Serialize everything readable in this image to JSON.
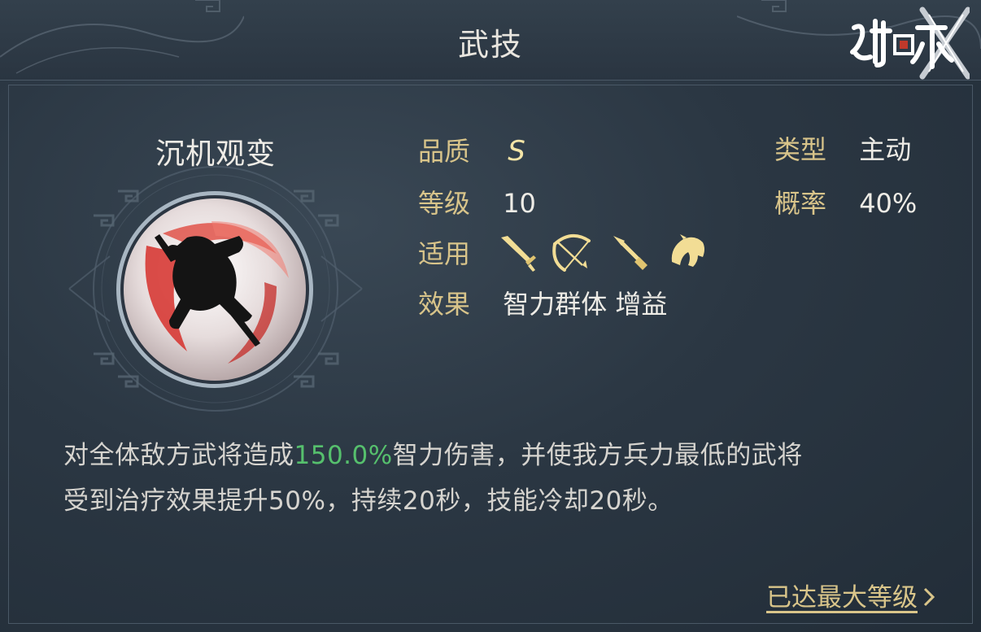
{
  "header": {
    "title": "武技",
    "logo_text": "鸿图之下"
  },
  "skill": {
    "name": "沉机观变",
    "icon": "warrior-silhouette-emblem-icon",
    "attributes": {
      "quality_label": "品质",
      "quality_value": "S",
      "type_label": "类型",
      "type_value": "主动",
      "level_label": "等级",
      "level_value": "10",
      "chance_label": "概率",
      "chance_value": "40%",
      "applicable_label": "适用",
      "applicable_icons": [
        "sword-icon",
        "bow-icon",
        "spear-icon",
        "horse-icon"
      ],
      "effect_label": "效果",
      "effect_value": "智力群体 增益"
    },
    "description": {
      "part1": "对全体敌方武将造成",
      "highlight": "150.0%",
      "part2": "智力伤害，并使我方兵力最低的武将",
      "line2": "受到治疗效果提升50%，持续20秒，技能冷却20秒。"
    },
    "max_level_text": "已达最大等级"
  },
  "colors": {
    "label_gold": "#d8c48a",
    "value_white": "#eeece6",
    "highlight_green": "#56c06d",
    "icon_gold": "#f2dd95",
    "panel_bg": "#2b3743"
  }
}
